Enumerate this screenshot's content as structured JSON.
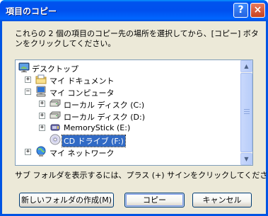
{
  "window": {
    "title": "項目のコピー",
    "help_glyph": "?",
    "close_glyph": "×"
  },
  "instruction": "これらの 2 個の項目のコピー先の場所を選択してから、[コピー] ボタンをクリックしてください。",
  "tree": {
    "items": [
      {
        "label": "デスクトップ",
        "icon": "desktop-icon",
        "expander": ""
      },
      {
        "label": "マイ ドキュメント",
        "icon": "my-documents-icon",
        "expander": "+"
      },
      {
        "label": "マイ コンピュータ",
        "icon": "my-computer-icon",
        "expander": "−"
      },
      {
        "label": "ローカル ディスク (C:)",
        "icon": "hard-disk-icon",
        "expander": "+"
      },
      {
        "label": "ローカル ディスク (D:)",
        "icon": "hard-disk-icon",
        "expander": "+"
      },
      {
        "label": "MemoryStick (E:)",
        "icon": "memory-stick-icon",
        "expander": "+"
      },
      {
        "label": "CD ドライブ (F:)",
        "icon": "cd-drive-icon",
        "expander": "",
        "selected": true
      },
      {
        "label": "マイ ネットワーク",
        "icon": "network-icon",
        "expander": "+"
      }
    ]
  },
  "hint": "サブ フォルダを表示するには、プラス (+) サインをクリックしてください。",
  "buttons": {
    "new_folder": "新しいフォルダの作成(M)",
    "copy": "コピー",
    "cancel": "キャンセル"
  },
  "colors": {
    "title_bar": "#0054e3",
    "selection": "#316ac5",
    "dialog_bg": "#ece9d8"
  }
}
